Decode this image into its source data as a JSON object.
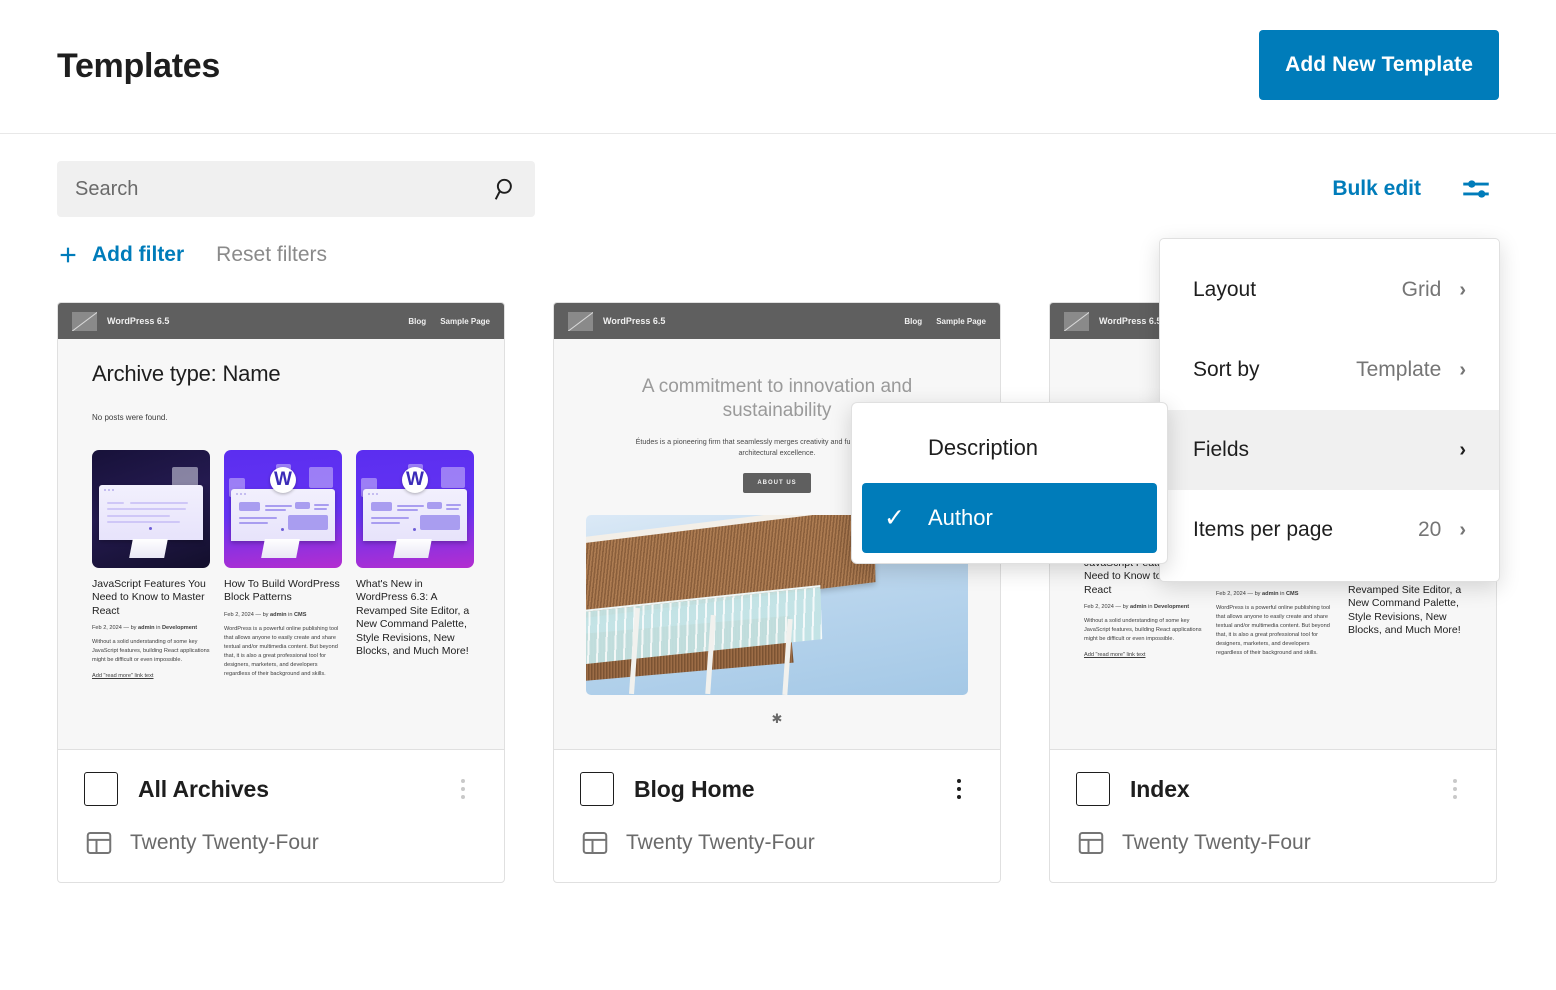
{
  "header": {
    "title": "Templates",
    "add_new_label": "Add New Template"
  },
  "toolbar": {
    "search_placeholder": "Search",
    "search_value": "",
    "search_icon": "search-icon",
    "bulk_edit_label": "Bulk edit",
    "view_options_icon": "sliders-icon"
  },
  "filters": {
    "add_filter_label": "Add filter",
    "add_filter_icon": "plus-icon",
    "reset_filters_label": "Reset filters"
  },
  "view_menu": {
    "items": [
      {
        "label": "Layout",
        "value": "Grid",
        "chevron": "›",
        "highlighted": false
      },
      {
        "label": "Sort by",
        "value": "Template",
        "chevron": "›",
        "highlighted": false
      },
      {
        "label": "Fields",
        "value": "",
        "chevron": "›",
        "highlighted": true
      },
      {
        "label": "Items per page",
        "value": "20",
        "chevron": "›",
        "highlighted": false
      }
    ]
  },
  "fields_menu": {
    "items": [
      {
        "label": "Description",
        "selected": false,
        "check": ""
      },
      {
        "label": "Author",
        "selected": true,
        "check": "✓"
      }
    ]
  },
  "preview_chrome": {
    "brand": "WordPress 6.5",
    "nav": [
      "Blog",
      "Sample Page"
    ]
  },
  "posts": [
    {
      "title": "JavaScript Features You Need to Know to Master React",
      "meta_date": "Feb 2, 2024",
      "meta_by": "by",
      "meta_author": "admin",
      "meta_in": "in",
      "meta_category": "Development",
      "excerpt": "Without a solid understanding of some key JavaScript features, building React applications might be difficult or even impossible.",
      "more": "Add \"read more\" link text"
    },
    {
      "title": "How To Build WordPress Block Patterns",
      "meta_date": "Feb 2, 2024",
      "meta_by": "by",
      "meta_author": "admin",
      "meta_in": "in",
      "meta_category": "CMS",
      "excerpt": "WordPress is a powerful online publishing tool that allows anyone to easily create and share textual and/or multimedia content. But beyond that, it is also a great professional tool for designers, marketers, and developers regardless of their background and skills.",
      "more": ""
    },
    {
      "title": "What's New in WordPress 6.3: A Revamped Site Editor, a New Command Palette, Style Revisions, New Blocks, and Much More!",
      "meta_date": "",
      "meta_by": "",
      "meta_author": "",
      "meta_in": "",
      "meta_category": "",
      "excerpt": "",
      "more": ""
    }
  ],
  "archive_preview": {
    "heading": "Archive type: Name",
    "no_posts": "No posts were found."
  },
  "blog_home_preview": {
    "hero_title": "A commitment to innovation and sustainability",
    "hero_sub": "Études is a pioneering firm that seamlessly merges creativity and functionality to redefine architectural excellence.",
    "hero_button": "ABOUT US",
    "asterisk": "✱"
  },
  "cards": [
    {
      "name": "All Archives",
      "theme": "Twenty Twenty-Four",
      "theme_icon": "template-icon",
      "kebab_icon": "more-options-icon",
      "kebab_active": false,
      "checkbox_checked": false
    },
    {
      "name": "Blog Home",
      "theme": "Twenty Twenty-Four",
      "theme_icon": "template-icon",
      "kebab_icon": "more-options-icon",
      "kebab_active": true,
      "checkbox_checked": false
    },
    {
      "name": "Index",
      "theme": "Twenty Twenty-Four",
      "theme_icon": "template-icon",
      "kebab_icon": "more-options-icon",
      "kebab_active": false,
      "checkbox_checked": false
    }
  ],
  "colors": {
    "accent": "#007cba",
    "text": "#1e1e1e",
    "muted": "#757575",
    "border": "#e0e0e0",
    "field_bg": "#f0f0f0"
  }
}
